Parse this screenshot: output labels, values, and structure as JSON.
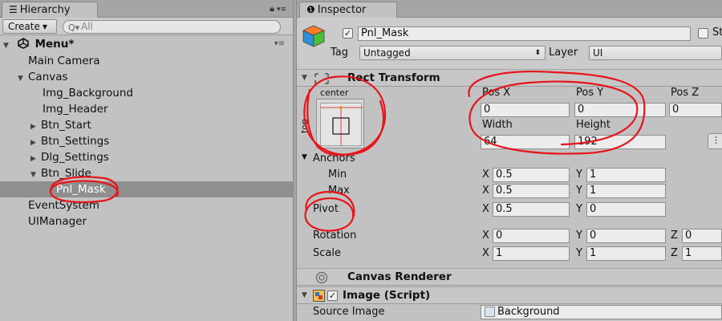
{
  "hierarchy": {
    "tab_label": "Hierarchy",
    "create_label": "Create",
    "search_placeholder": "All",
    "scene_name": "Menu*",
    "items": [
      {
        "label": "Main Camera"
      },
      {
        "label": "Canvas"
      },
      {
        "label": "Img_Background"
      },
      {
        "label": "Img_Header"
      },
      {
        "label": "Btn_Start"
      },
      {
        "label": "Btn_Settings"
      },
      {
        "label": "Dlg_Settings"
      },
      {
        "label": "Btn_Slide"
      },
      {
        "label": "Pnl_Mask"
      },
      {
        "label": "EventSystem"
      },
      {
        "label": "UIManager"
      }
    ],
    "selected_item": "Pnl_Mask"
  },
  "inspector": {
    "tab_label": "Inspector",
    "object_name": "Pnl_Mask",
    "object_active": true,
    "static_label": "St",
    "tag_label": "Tag",
    "tag_value": "Untagged",
    "layer_label": "Layer",
    "layer_value": "UI",
    "rect_transform": {
      "title": "Rect Transform",
      "anchor_preset_h": "center",
      "anchor_preset_v": "top",
      "pos_x_label": "Pos X",
      "pos_y_label": "Pos Y",
      "pos_z_label": "Pos Z",
      "pos_x": "0",
      "pos_y": "0",
      "pos_z": "0",
      "width_label": "Width",
      "height_label": "Height",
      "width": "64",
      "height": "192",
      "anchors_label": "Anchors",
      "min_label": "Min",
      "max_label": "Max",
      "min_x": "0.5",
      "min_y": "1",
      "max_x": "0.5",
      "max_y": "1",
      "pivot_label": "Pivot",
      "pivot_x": "0.5",
      "pivot_y": "0",
      "rotation_label": "Rotation",
      "rot_x": "0",
      "rot_y": "0",
      "rot_z": "0",
      "scale_label": "Scale",
      "scale_x": "1",
      "scale_y": "1",
      "scale_z": "1",
      "x_axis": "X",
      "y_axis": "Y",
      "z_axis": "Z"
    },
    "canvas_renderer": {
      "title": "Canvas Renderer"
    },
    "image_script": {
      "title": "Image (Script)",
      "enabled": true,
      "source_image_label": "Source Image",
      "source_image_value": "Background"
    }
  },
  "annotation_color": "#e8141a"
}
